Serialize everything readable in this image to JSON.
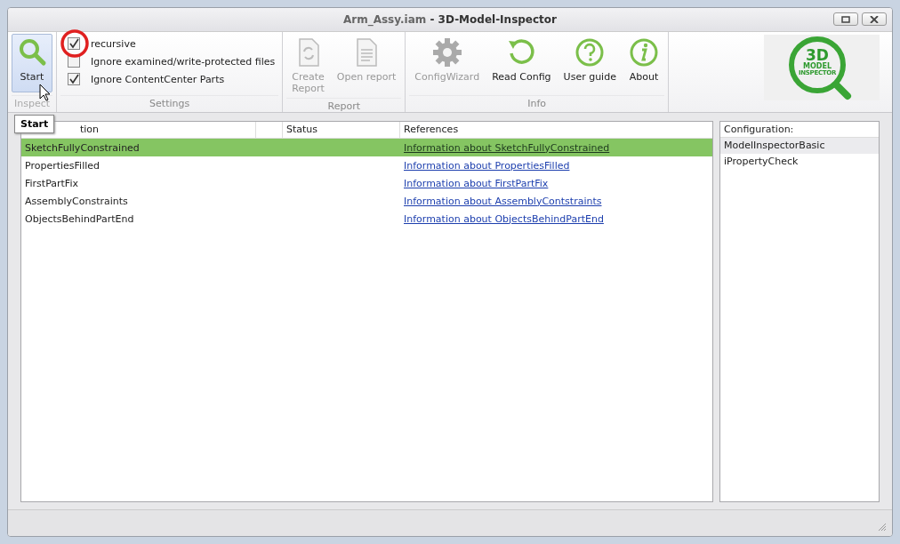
{
  "window": {
    "title_file": "Arm_Assy.iam",
    "title_app": "- 3D-Model-Inspector"
  },
  "ribbon": {
    "groups": [
      {
        "label": "Inspect",
        "kind": "inspect",
        "disabled": true,
        "buttons": [
          {
            "label": "Start",
            "disabled": false,
            "hovered": true
          }
        ]
      },
      {
        "label": "Settings",
        "kind": "settings",
        "disabled": false,
        "checkboxes": [
          {
            "label": "recursive",
            "checked": true
          },
          {
            "label": "Ignore examined/write-protected files",
            "checked": false
          },
          {
            "label": "Ignore ContentCenter Parts",
            "checked": true
          }
        ]
      },
      {
        "label": "Report",
        "kind": "buttons",
        "disabled": false,
        "buttons": [
          {
            "label": "Create\nReport",
            "disabled": true,
            "hovered": false
          },
          {
            "label": "Open report",
            "disabled": true,
            "hovered": false
          }
        ]
      },
      {
        "label": "Info",
        "kind": "buttons",
        "disabled": false,
        "buttons": [
          {
            "label": "ConfigWizard",
            "disabled": true,
            "hovered": false
          },
          {
            "label": "Read Config",
            "disabled": false,
            "hovered": false
          },
          {
            "label": "User guide",
            "disabled": false,
            "hovered": false
          },
          {
            "label": "About",
            "disabled": false,
            "hovered": false
          }
        ]
      }
    ],
    "logo": {
      "line_1": "3D",
      "line_2": "MODEL",
      "line_3": "INSPECTOR"
    }
  },
  "tooltip": "Start",
  "table": {
    "columns": [
      "tion",
      "Status",
      "References"
    ],
    "rows": [
      {
        "name": "SketchFullyConstrained",
        "reference": "Information about SketchFullyConstrained",
        "selected": true
      },
      {
        "name": "PropertiesFilled",
        "reference": "Information about PropertiesFilled",
        "selected": false
      },
      {
        "name": "FirstPartFix",
        "reference": "Information about FirstPartFix",
        "selected": false
      },
      {
        "name": "AssemblyConstraints",
        "reference": "Information about AssemblyContstraints",
        "selected": false
      },
      {
        "name": "ObjectsBehindPartEnd",
        "reference": "Information about ObjectsBehindPartEnd",
        "selected": false
      }
    ]
  },
  "configuration": {
    "header": "Configuration:",
    "items": [
      {
        "label": "ModelInspectorBasic",
        "selected": true
      },
      {
        "label": "iPropertyCheck",
        "selected": false
      }
    ]
  }
}
